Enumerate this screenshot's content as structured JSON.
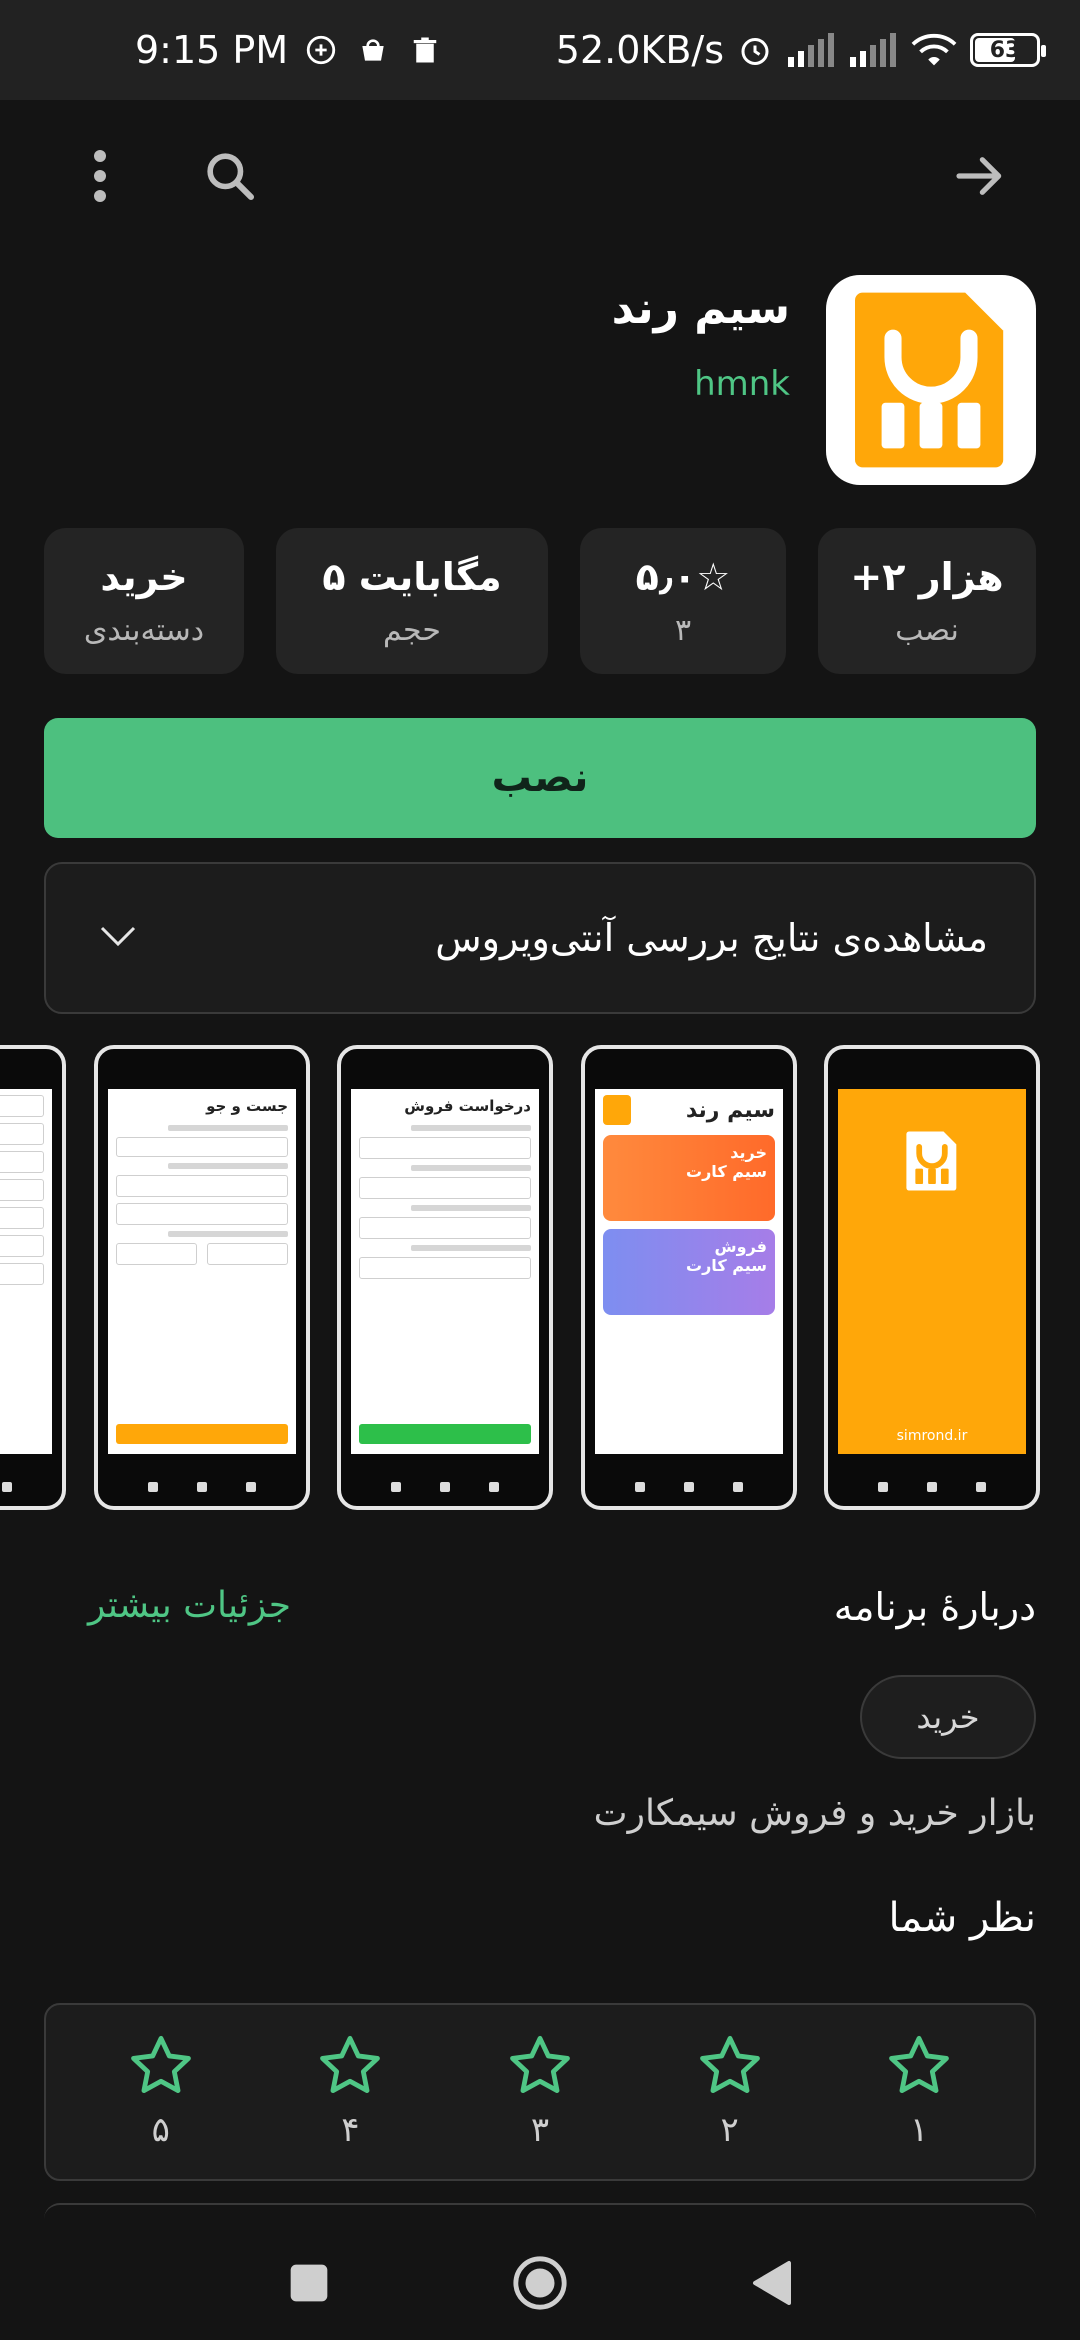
{
  "status_bar": {
    "time": "9:15 PM",
    "net_speed": "52.0KB/s",
    "battery": "63"
  },
  "toolbar": {
    "menu_icon": "more-vertical-icon",
    "search_icon": "search-icon",
    "forward_icon": "arrow-right-icon"
  },
  "app": {
    "title": "سیم رند",
    "developer": "hmnk",
    "icon_color": "#ffa709"
  },
  "stats": [
    {
      "value": "+۲ هزار",
      "label": "نصب"
    },
    {
      "value": "۵٫۰☆",
      "label": "۳"
    },
    {
      "value": "۵ مگابایت",
      "label": "حجم"
    },
    {
      "value": "خرید",
      "label": "دسته‌بندی"
    }
  ],
  "install": {
    "label": "نصب",
    "color": "#4dc07f"
  },
  "antivirus": {
    "label": "مشاهده‌ی نتایج بررسی آنتی‌ویروس"
  },
  "screenshots": {
    "splash_url": "simrond.ir",
    "home_title": "سیم رند",
    "buy_card": "خرید\nسیم کارت",
    "sell_card": "فروش\nسیم کارت",
    "sell_request_title": "درخواست فروش",
    "search_title": "جست و جو"
  },
  "about": {
    "title": "دربارهٔ برنامه",
    "more_link": "جزئیات بیشتر",
    "tag": "خرید",
    "description": "بازار خرید و فروش سیمکارت"
  },
  "review": {
    "title": "نظر شما",
    "stars": [
      "۱",
      "۲",
      "۳",
      "۴",
      "۵"
    ]
  },
  "accent": "#4fc685"
}
